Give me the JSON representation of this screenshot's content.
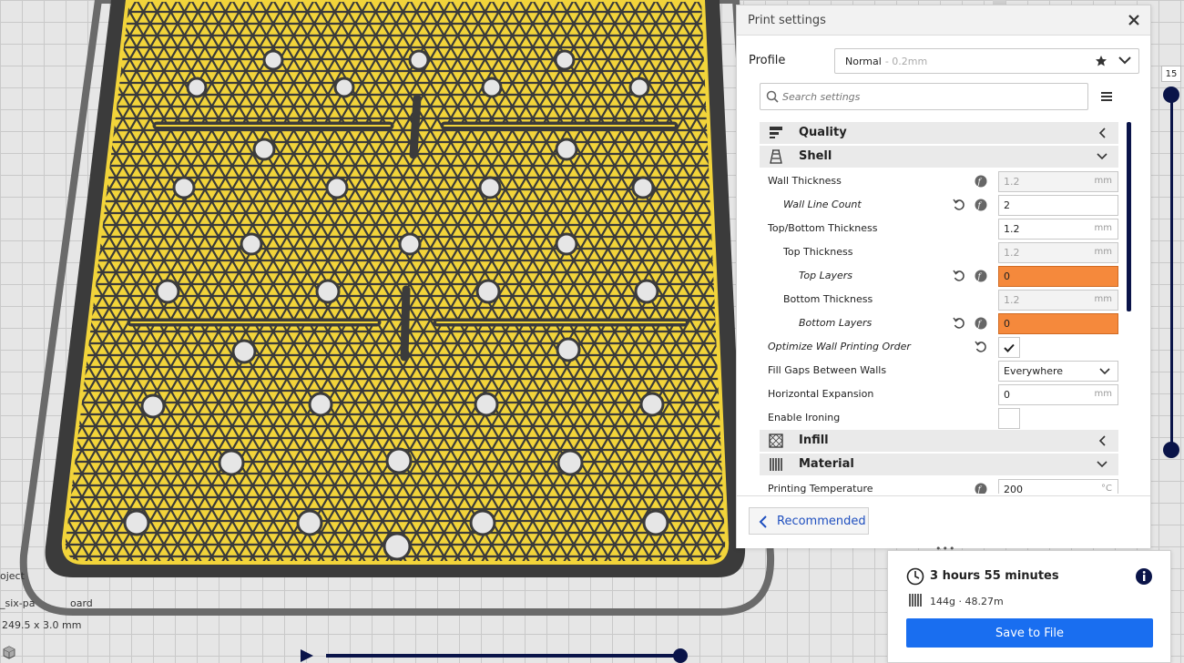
{
  "viewport": {
    "object_list_partial": "oject",
    "object_name_partial": "_six-pa",
    "object_name_suffix": "oard",
    "dimensions_partial": "249.5 x 3.0 mm",
    "layer_current": "15"
  },
  "print_settings": {
    "title": "Print settings",
    "profile_label": "Profile",
    "profile_name": "Normal",
    "profile_sub": "- 0.2mm",
    "search_placeholder": "Search settings",
    "categories": {
      "quality": "Quality",
      "shell": "Shell",
      "infill": "Infill",
      "material": "Material"
    },
    "settings": {
      "wall_thickness": {
        "label": "Wall Thickness",
        "value": "1.2",
        "unit": "mm"
      },
      "wall_line_count": {
        "label": "Wall Line Count",
        "value": "2"
      },
      "top_bottom_thickness": {
        "label": "Top/Bottom Thickness",
        "value": "1.2",
        "unit": "mm"
      },
      "top_thickness": {
        "label": "Top Thickness",
        "value": "1.2",
        "unit": "mm"
      },
      "top_layers": {
        "label": "Top Layers",
        "value": "0"
      },
      "bottom_thickness": {
        "label": "Bottom Thickness",
        "value": "1.2",
        "unit": "mm"
      },
      "bottom_layers": {
        "label": "Bottom Layers",
        "value": "0"
      },
      "optimize_wall_order": {
        "label": "Optimize Wall Printing Order",
        "checked": true
      },
      "fill_gaps": {
        "label": "Fill Gaps Between Walls",
        "value": "Everywhere"
      },
      "horizontal_expansion": {
        "label": "Horizontal Expansion",
        "value": "0",
        "unit": "mm"
      },
      "enable_ironing": {
        "label": "Enable Ironing",
        "checked": false
      },
      "printing_temperature": {
        "label": "Printing Temperature",
        "value": "200",
        "unit": "°C"
      }
    },
    "recommended_label": "Recommended"
  },
  "job": {
    "print_time": "3 hours 55 minutes",
    "material_estimate": "144g · 48.27m",
    "save_label": "Save to File"
  },
  "colors": {
    "accent_blue": "#196ef0",
    "dark_navy": "#0a1449",
    "error_orange": "#f5893c",
    "infill_yellow": "#f2d43a"
  }
}
